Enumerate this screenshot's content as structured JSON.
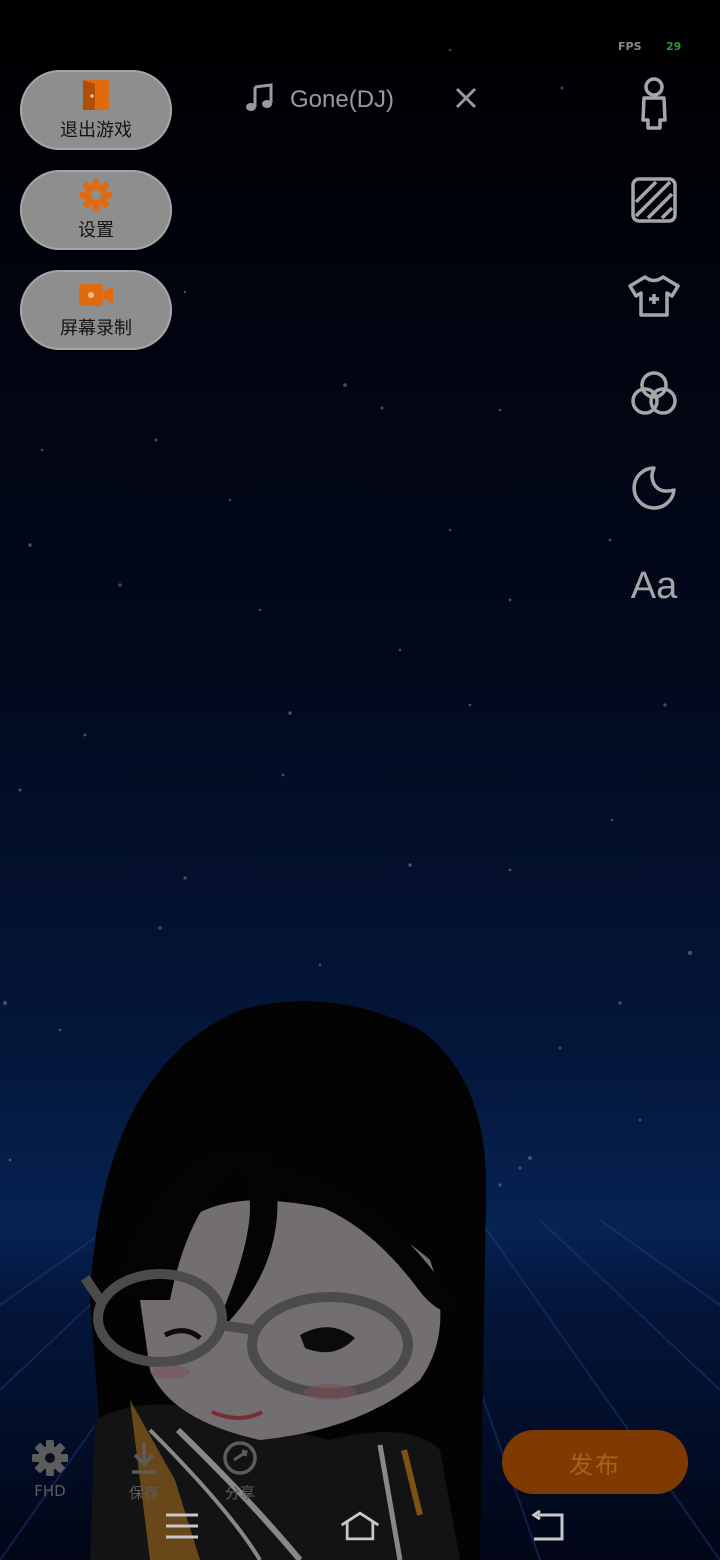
{
  "status": {
    "fps_label": "FPS",
    "fps_value": "29"
  },
  "left_menu": [
    {
      "icon": "exit-door-icon",
      "label": "退出游戏"
    },
    {
      "icon": "settings-gear-icon",
      "label": "设置"
    },
    {
      "icon": "screen-record-icon",
      "label": "屏幕录制"
    }
  ],
  "music": {
    "icon": "music-note-icon",
    "title": "Gone(DJ)",
    "close_icon": "close-icon"
  },
  "right_toolbar": {
    "items": [
      {
        "icon": "avatar-person-icon"
      },
      {
        "icon": "background-pattern-icon"
      },
      {
        "icon": "clothing-icon"
      },
      {
        "icon": "filter-circles-icon"
      },
      {
        "icon": "sticker-icon"
      },
      {
        "icon": "text-icon",
        "label": "Aa"
      }
    ]
  },
  "bottom_bar": {
    "quality": {
      "icon": "gear-icon",
      "label": "FHD"
    },
    "save": {
      "icon": "download-icon",
      "label": "保存"
    },
    "share": {
      "icon": "share-icon",
      "label": "分享"
    },
    "publish_label": "发布"
  },
  "colors": {
    "accent": "#f07414",
    "publish_bg": "#7f3a02"
  }
}
